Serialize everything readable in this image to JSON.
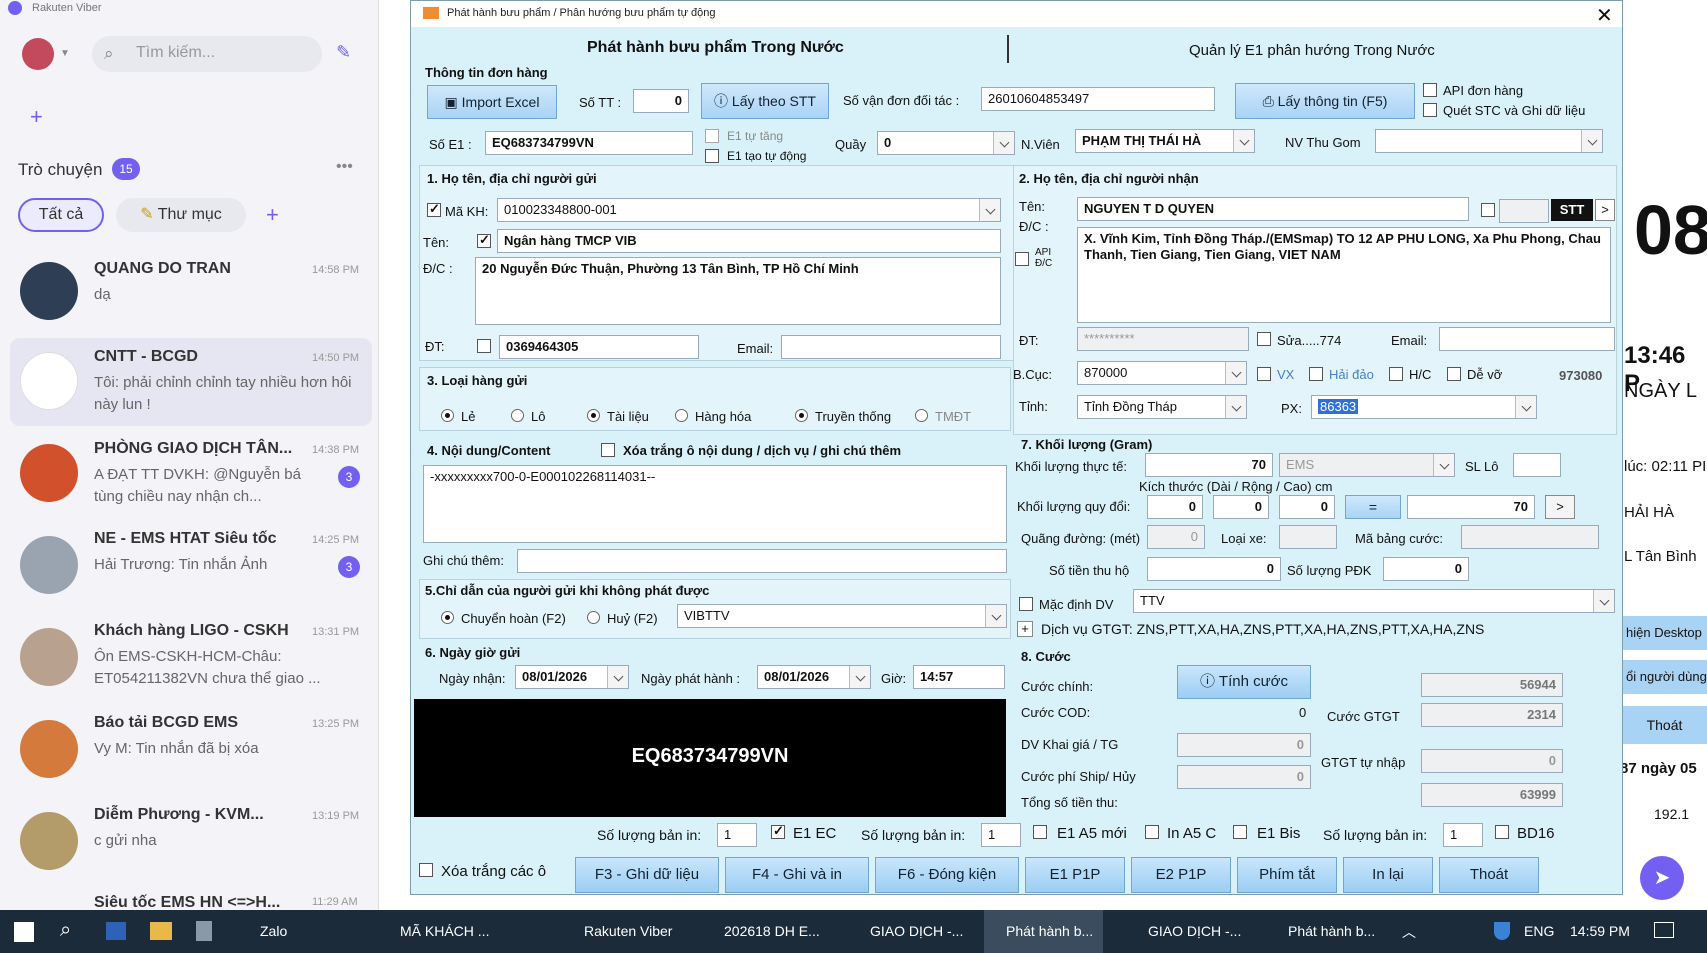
{
  "viber": {
    "app_title": "Rakuten Viber",
    "search_placeholder": "Tìm kiếm...",
    "chats_label": "Trò chuyện",
    "chats_count": "15",
    "filter_all": "Tất cả",
    "filter_folder": "Thư mục",
    "conversations": [
      {
        "name": "QUANG DO TRAN",
        "message": "dạ",
        "time": "14:58 PM",
        "badge": ""
      },
      {
        "name": "CNTT - BCGD",
        "message": "Tôi: phải chỉnh chỉnh tay nhiều hơn hôi này lun !",
        "time": "14:50 PM",
        "badge": ""
      },
      {
        "name": "PHÒNG GIAO DỊCH TÂN...",
        "message": "A ĐẠT TT DVKH: @Nguyễn bá tùng chiều nay nhận ch...",
        "time": "14:38 PM",
        "badge": "3"
      },
      {
        "name": "NE - EMS HTAT Siêu tốc",
        "message": "Hải Trương: Tin nhắn Ảnh",
        "time": "14:25 PM",
        "badge": "3"
      },
      {
        "name": "Khách hàng LIGO - CSKH",
        "message": "Ôn EMS-CSKH-HCM-Châu: ET054211382VN chưa thể giao ...",
        "time": "13:31 PM",
        "badge": ""
      },
      {
        "name": "Báo tải BCGD EMS",
        "message": "Vy M: Tin nhắn đã bị xóa",
        "time": "13:25 PM",
        "badge": ""
      },
      {
        "name": "Diễm Phương - KVM...",
        "message": "c gửi nha",
        "time": "13:19 PM",
        "badge": ""
      },
      {
        "name": "Siêu tốc EMS HN <=>H...",
        "message": "",
        "time": "11:29 AM",
        "badge": ""
      }
    ]
  },
  "behind": {
    "big_number": "08",
    "time_text": "13:46 P",
    "date_text": "NGÀY L",
    "line1": "lúc: 02:11 PI",
    "line2": "HẢI HÀ",
    "line3": "L Tân Bình",
    "btn1": "hiện Desktop",
    "btn2": "ổi người dùng",
    "btn3": "Thoát",
    "line4": "87 ngày 05",
    "ip": "192.1"
  },
  "dialog": {
    "title": "Phát hành bưu phẩm / Phân hướng bưu phẩm tự động",
    "tab_left": "Phát hành bưu phẩm Trong Nước",
    "tab_right": "Quản lý E1 phân hướng Trong Nước",
    "order_info": "Thông tin đơn hàng",
    "import_excel": "Import Excel",
    "so_tt_label": "Số TT :",
    "so_tt_value": "0",
    "lay_theo_stt": "Lấy theo STT",
    "so_van_don_label": "Số vận đơn đối tác :",
    "so_van_don_value": "26010604853497",
    "lay_thong_tin": "Lấy thông tin (F5)",
    "api_don_hang": "API đơn hàng",
    "quet_stc": "Quét STC và Ghi dữ liệu",
    "so_e1_label": "Số E1 :",
    "so_e1_value": "EQ683734799VN",
    "e1_tu_tang": "E1 tự tăng",
    "e1_tao_tu_dong": "E1 tạo tự động",
    "quay_label": "Quầy",
    "quay_value": "0",
    "nvien_label": "N.Viên",
    "nvien_value": "PHẠM THỊ THÁI HÀ",
    "nv_thu_gom_label": "NV Thu Gom",
    "nv_thu_gom_value": "",
    "sender": {
      "section": "1. Họ tên, địa chỉ người gửi",
      "ma_kh_label": "Mã KH:",
      "ma_kh_value": "010023348800-001",
      "ten_label": "Tên:",
      "ten_value": "Ngân hàng TMCP VIB",
      "dc_label": "Đ/C :",
      "dc_value": "20 Nguyễn Đức Thuận, Phường 13 Tân Bình, TP Hồ Chí Minh",
      "dt_label": "ĐT:",
      "dt_value": "0369464305",
      "email_label": "Email:",
      "email_value": ""
    },
    "receiver": {
      "section": "2. Họ tên, địa chỉ người nhận",
      "ten_label": "Tên:",
      "ten_value": "NGUYEN T D QUYEN",
      "stt_label": "STT",
      "dc_label": "Đ/C :",
      "api_dc": "API Đ/C",
      "dc_value": "X. Vĩnh Kim, Tỉnh Đồng Tháp./(EMSmap) TO 12 AP PHU LONG, Xa Phu Phong, Chau Thanh, Tien Giang, Tien Giang, VIET NAM",
      "dt_label": "ĐT:",
      "dt_value": "**********",
      "sua_label": "Sửa.....774",
      "email_label": "Email:",
      "email_value": "",
      "bcuc_label": "B.Cục:",
      "bcuc_value": "870000",
      "vx": "VX",
      "hai_dao": "Hải đảo",
      "hc": "H/C",
      "de_vo": "Dễ vỡ",
      "code": "973080",
      "tinh_label": "Tỉnh:",
      "tinh_value": "Tỉnh Đồng Tháp",
      "px_label": "PX:",
      "px_value": "86363"
    },
    "loai_hang": {
      "section": "3. Loại hàng gửi",
      "le": "Lẻ",
      "lo": "Lô",
      "tai_lieu": "Tài liệu",
      "hang_hoa": "Hàng hóa",
      "truyen_thong": "Truyền thống",
      "tmdt": "TMĐT"
    },
    "noi_dung": {
      "section": "4. Nội dung/Content",
      "xoa_trang": "Xóa trắng ô nội dung / dịch vụ / ghi chú thêm",
      "content_value": "-xxxxxxxxx700-0-E000102268114031--",
      "ghi_chu_label": "Ghi chú thêm:",
      "ghi_chu_value": ""
    },
    "chi_dan": {
      "section": "5.Chỉ dẫn của người gửi khi không phát được",
      "chuyen_hoan": "Chuyển hoàn (F2)",
      "huy": "Huỷ (F2)",
      "value": "VIBTTV"
    },
    "ngay_gio": {
      "section": "6. Ngày giờ gửi",
      "ngay_nhan_label": "Ngày nhận:",
      "ngay_nhan_value": "08/01/2026",
      "ngay_phat_label": "Ngày phát hành :",
      "ngay_phat_value": "08/01/2026",
      "gio_label": "Giờ:",
      "gio_value": "14:57"
    },
    "barcode_text": "EQ683734799VN",
    "khoi_luong": {
      "section": "7. Khối lượng (Gram)",
      "thuc_te_label": "Khối lượng thực tế:",
      "thuc_te_value": "70",
      "service": "EMS",
      "sl_lo_label": "SL Lô",
      "sl_lo_value": "",
      "kich_thuoc_label": "Kích thước (Dài / Rộng / Cao) cm",
      "quy_doi_label": "Khối lượng quy đổi:",
      "dai": "0",
      "rong": "0",
      "cao": "0",
      "equals": "=",
      "quy_doi_value": "70",
      "next": ">",
      "quang_duong_label": "Quãng đường: (mét)",
      "quang_duong_value": "0",
      "loai_xe_label": "Loại xe:",
      "loai_xe_value": "",
      "ma_bang_cuoc_label": "Mã bảng cước:",
      "ma_bang_cuoc_value": "",
      "so_tien_thu_ho_label": "Số tiền thu hộ",
      "so_tien_thu_ho_value": "0",
      "so_luong_pdk_label": "Số lượng PĐK",
      "so_luong_pdk_value": "0",
      "mac_dinh_dv": "Mặc định DV",
      "dv_value": "TTV",
      "dich_vu_gtgt": "Dịch vụ GTGT: ZNS,PTT,XA,HA,ZNS,PTT,XA,HA,ZNS,PTT,XA,HA,ZNS"
    },
    "cuoc": {
      "section": "8. Cước",
      "cuoc_chinh_label": "Cước chính:",
      "tinh_cuoc": "Tính cước",
      "cuoc_chinh_value": "56944",
      "cuoc_cod_label": "Cước COD:",
      "cuoc_cod_value": "0",
      "cuoc_gtgt_label": "Cước GTGT",
      "cuoc_gtgt_value": "2314",
      "dv_khai_gia_label": "DV Khai giá / TG",
      "dv_khai_gia_value": "0",
      "gtgt_tu_nhap_label": "GTGT tự nhập",
      "gtgt_tu_nhap_value": "0",
      "ship_huy_label": "Cước phí Ship/ Hủy",
      "ship_huy_value": "0",
      "tong_label": "Tổng số tiền thu:",
      "tong_value": "63999"
    },
    "print": {
      "so_luong_label": "Số lượng bản in:",
      "qty1": "1",
      "e1ec": "E1 EC",
      "qty2": "1",
      "e1a5": "E1 A5 mới",
      "ina5c": "In A5 C",
      "e1bis": "E1 Bis",
      "qty3": "1",
      "bd16": "BD16"
    },
    "footer": {
      "xoa_trang_cac_o": "Xóa trắng các ô",
      "f3": "F3 - Ghi dữ liệu",
      "f4": "F4 - Ghi và in",
      "f6": "F6 - Đóng kiện",
      "e1p1p": "E1 P1P",
      "e2p1p": "E2 P1P",
      "phim_tat": "Phím tắt",
      "in_lai": "In lại",
      "thoat": "Thoát"
    }
  },
  "taskbar": {
    "items": [
      "Zalo",
      "MÃ KHÁCH ...",
      "Rakuten Viber",
      "202618 DH E...",
      "GIAO DỊCH -...",
      "Phát hành b...",
      "GIAO DỊCH -...",
      "Phát hành b..."
    ],
    "lang": "ENG",
    "clock": "14:59 PM"
  },
  "colors": {
    "viber_purple": "#7360f2",
    "dialog_bg": "#d9f2f9",
    "taskbar": "#1c2b3a"
  }
}
